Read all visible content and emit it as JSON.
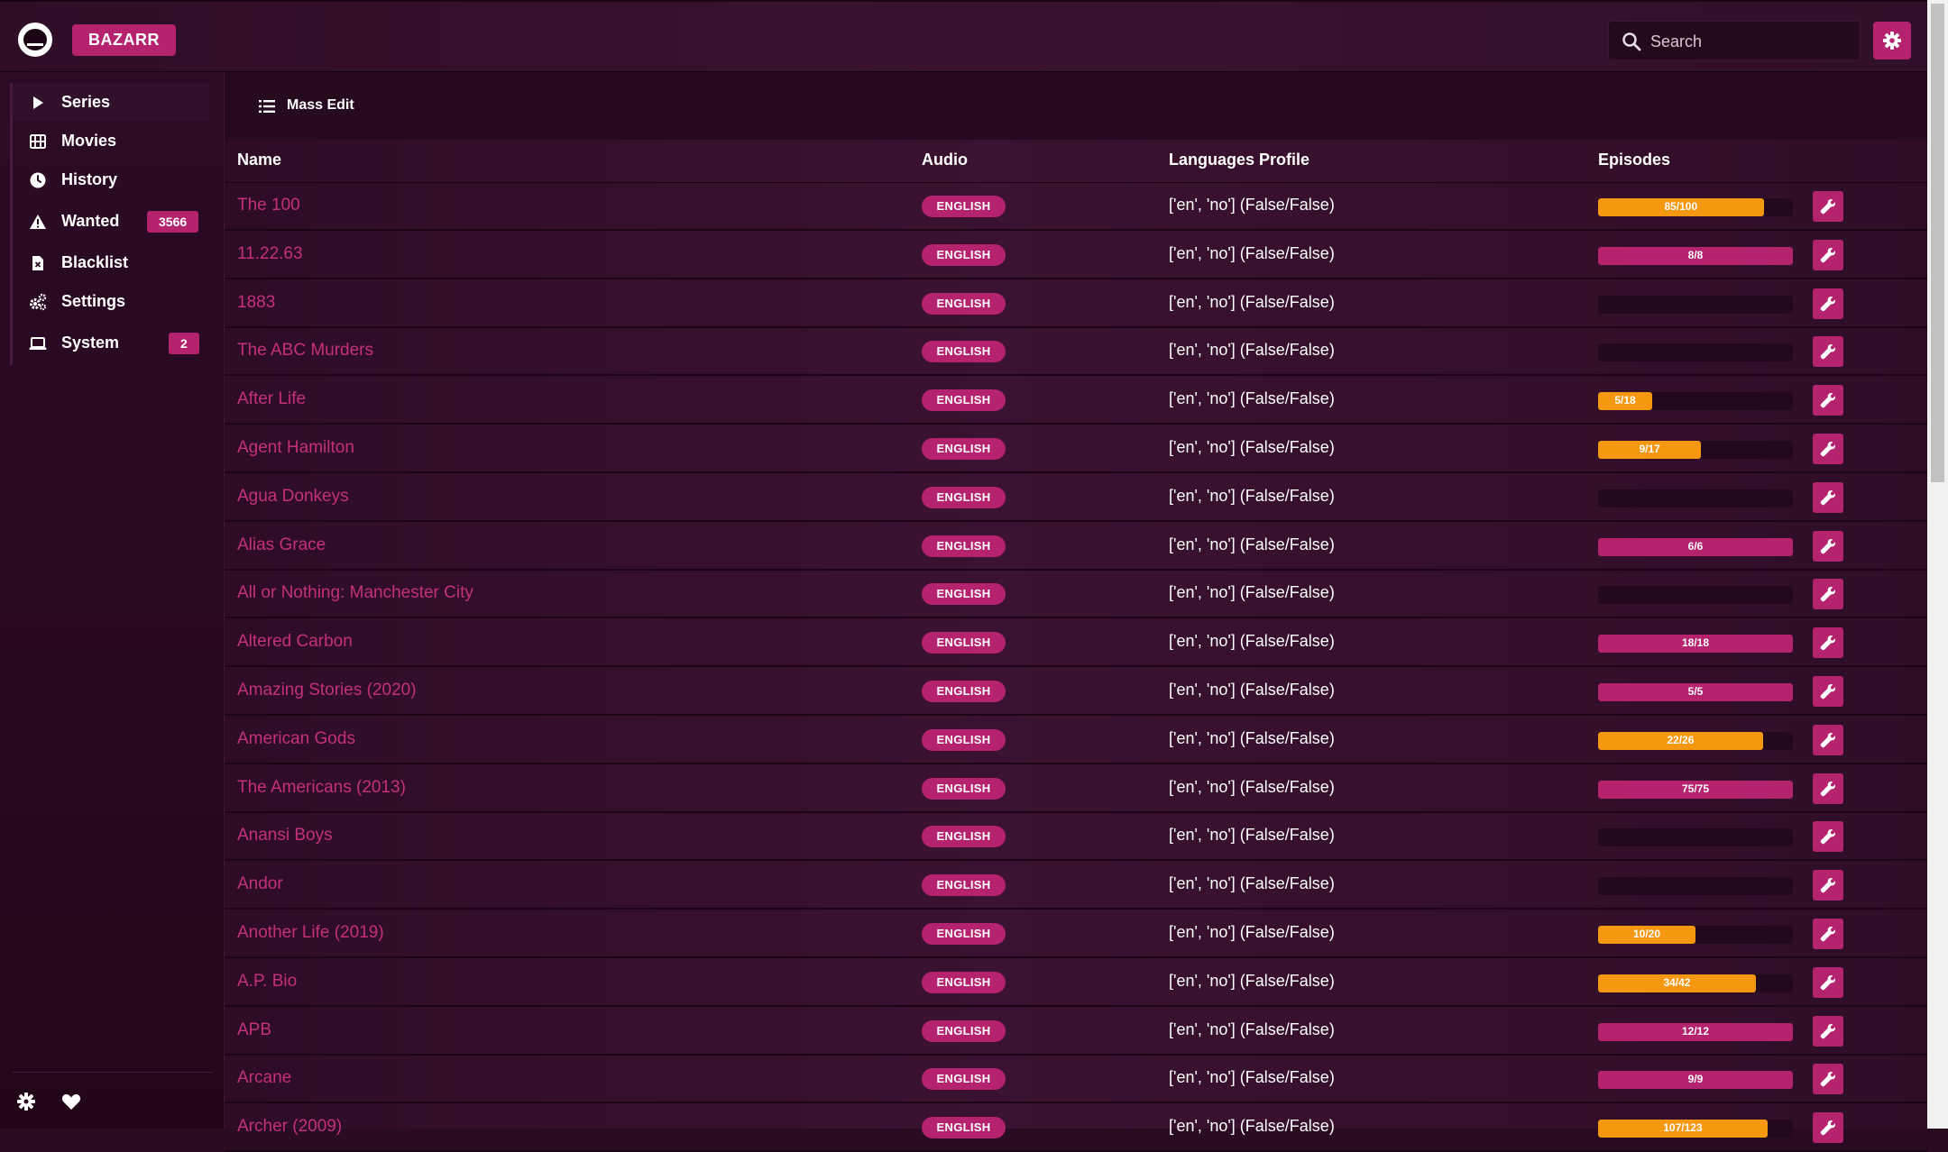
{
  "app": {
    "brand": "BAZARR",
    "logo": "bazarr-logo"
  },
  "search": {
    "placeholder": "Search"
  },
  "sidebar": {
    "items": [
      {
        "label": "Series",
        "icon": "play-icon",
        "active": true
      },
      {
        "label": "Movies",
        "icon": "film-icon"
      },
      {
        "label": "History",
        "icon": "clock-icon"
      },
      {
        "label": "Wanted",
        "icon": "warning-icon",
        "badge": "3566"
      },
      {
        "label": "Blacklist",
        "icon": "file-x-icon"
      },
      {
        "label": "Settings",
        "icon": "cogs-icon"
      },
      {
        "label": "System",
        "icon": "laptop-icon",
        "badge": "2"
      }
    ],
    "footer": {
      "settings_icon": "gear-icon",
      "donate_icon": "heart-icon"
    }
  },
  "toolbar": {
    "mass_edit": "Mass Edit"
  },
  "table": {
    "columns": [
      "Name",
      "Audio",
      "Languages Profile",
      "Episodes"
    ],
    "rows": [
      {
        "name": "The 100",
        "audio": "ENGLISH",
        "profile": "['en', 'no'] (False/False)",
        "episodes": "85/100",
        "progress": 0.85,
        "status": "partial"
      },
      {
        "name": "11.22.63",
        "audio": "ENGLISH",
        "profile": "['en', 'no'] (False/False)",
        "episodes": "8/8",
        "progress": 1.0,
        "status": "complete"
      },
      {
        "name": "1883",
        "audio": "ENGLISH",
        "profile": "['en', 'no'] (False/False)",
        "episodes": "",
        "progress": 0,
        "status": "empty"
      },
      {
        "name": "The ABC Murders",
        "audio": "ENGLISH",
        "profile": "['en', 'no'] (False/False)",
        "episodes": "",
        "progress": 0,
        "status": "empty"
      },
      {
        "name": "After Life",
        "audio": "ENGLISH",
        "profile": "['en', 'no'] (False/False)",
        "episodes": "5/18",
        "progress": 0.278,
        "status": "partial"
      },
      {
        "name": "Agent Hamilton",
        "audio": "ENGLISH",
        "profile": "['en', 'no'] (False/False)",
        "episodes": "9/17",
        "progress": 0.529,
        "status": "partial"
      },
      {
        "name": "Agua Donkeys",
        "audio": "ENGLISH",
        "profile": "['en', 'no'] (False/False)",
        "episodes": "",
        "progress": 0,
        "status": "empty"
      },
      {
        "name": "Alias Grace",
        "audio": "ENGLISH",
        "profile": "['en', 'no'] (False/False)",
        "episodes": "6/6",
        "progress": 1.0,
        "status": "complete"
      },
      {
        "name": "All or Nothing: Manchester City",
        "audio": "ENGLISH",
        "profile": "['en', 'no'] (False/False)",
        "episodes": "",
        "progress": 0,
        "status": "empty"
      },
      {
        "name": "Altered Carbon",
        "audio": "ENGLISH",
        "profile": "['en', 'no'] (False/False)",
        "episodes": "18/18",
        "progress": 1.0,
        "status": "complete"
      },
      {
        "name": "Amazing Stories (2020)",
        "audio": "ENGLISH",
        "profile": "['en', 'no'] (False/False)",
        "episodes": "5/5",
        "progress": 1.0,
        "status": "complete"
      },
      {
        "name": "American Gods",
        "audio": "ENGLISH",
        "profile": "['en', 'no'] (False/False)",
        "episodes": "22/26",
        "progress": 0.846,
        "status": "partial"
      },
      {
        "name": "The Americans (2013)",
        "audio": "ENGLISH",
        "profile": "['en', 'no'] (False/False)",
        "episodes": "75/75",
        "progress": 1.0,
        "status": "complete"
      },
      {
        "name": "Anansi Boys",
        "audio": "ENGLISH",
        "profile": "['en', 'no'] (False/False)",
        "episodes": "",
        "progress": 0,
        "status": "empty"
      },
      {
        "name": "Andor",
        "audio": "ENGLISH",
        "profile": "['en', 'no'] (False/False)",
        "episodes": "",
        "progress": 0,
        "status": "empty"
      },
      {
        "name": "Another Life (2019)",
        "audio": "ENGLISH",
        "profile": "['en', 'no'] (False/False)",
        "episodes": "10/20",
        "progress": 0.5,
        "status": "partial"
      },
      {
        "name": "A.P. Bio",
        "audio": "ENGLISH",
        "profile": "['en', 'no'] (False/False)",
        "episodes": "34/42",
        "progress": 0.81,
        "status": "partial"
      },
      {
        "name": "APB",
        "audio": "ENGLISH",
        "profile": "['en', 'no'] (False/False)",
        "episodes": "12/12",
        "progress": 1.0,
        "status": "complete"
      },
      {
        "name": "Arcane",
        "audio": "ENGLISH",
        "profile": "['en', 'no'] (False/False)",
        "episodes": "9/9",
        "progress": 1.0,
        "status": "complete"
      },
      {
        "name": "Archer (2009)",
        "audio": "ENGLISH",
        "profile": "['en', 'no'] (False/False)",
        "episodes": "107/123",
        "progress": 0.87,
        "status": "partial"
      }
    ],
    "action_icon": "wrench-icon"
  },
  "colors": {
    "accent": "#b5226e",
    "partial": "#f5970f",
    "background": "#2a0c22",
    "link": "#c4307b"
  }
}
